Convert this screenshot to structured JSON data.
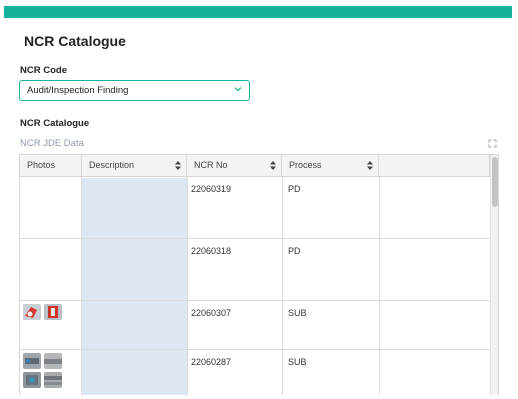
{
  "header": {
    "title": "NCR Catalogue"
  },
  "ncr_code": {
    "label": "NCR Code",
    "selected": "Audit/Inspection Finding",
    "icon": "chevron-down-icon"
  },
  "catalogue": {
    "label": "NCR Catalogue",
    "source_label": "NCR JDE Data",
    "expand_icon": "expand-icon",
    "columns": [
      "Photos",
      "Description",
      "NCR No",
      "Process"
    ],
    "rows": [
      {
        "ncr_no": "22060319",
        "process": "PD",
        "photos": []
      },
      {
        "ncr_no": "22060318",
        "process": "PD",
        "photos": []
      },
      {
        "ncr_no": "22060307",
        "process": "SUB",
        "photos": [
          "red-part-photo",
          "red-part-photo"
        ]
      },
      {
        "ncr_no": "22060287",
        "process": "SUB",
        "photos": [
          "metal-part-photo",
          "metal-part-photo",
          "metal-part-photo",
          "metal-part-photo"
        ]
      }
    ]
  },
  "colors": {
    "accent": "#14b39a",
    "description_column": "#dde7f3",
    "muted_text": "#8f99b0"
  }
}
